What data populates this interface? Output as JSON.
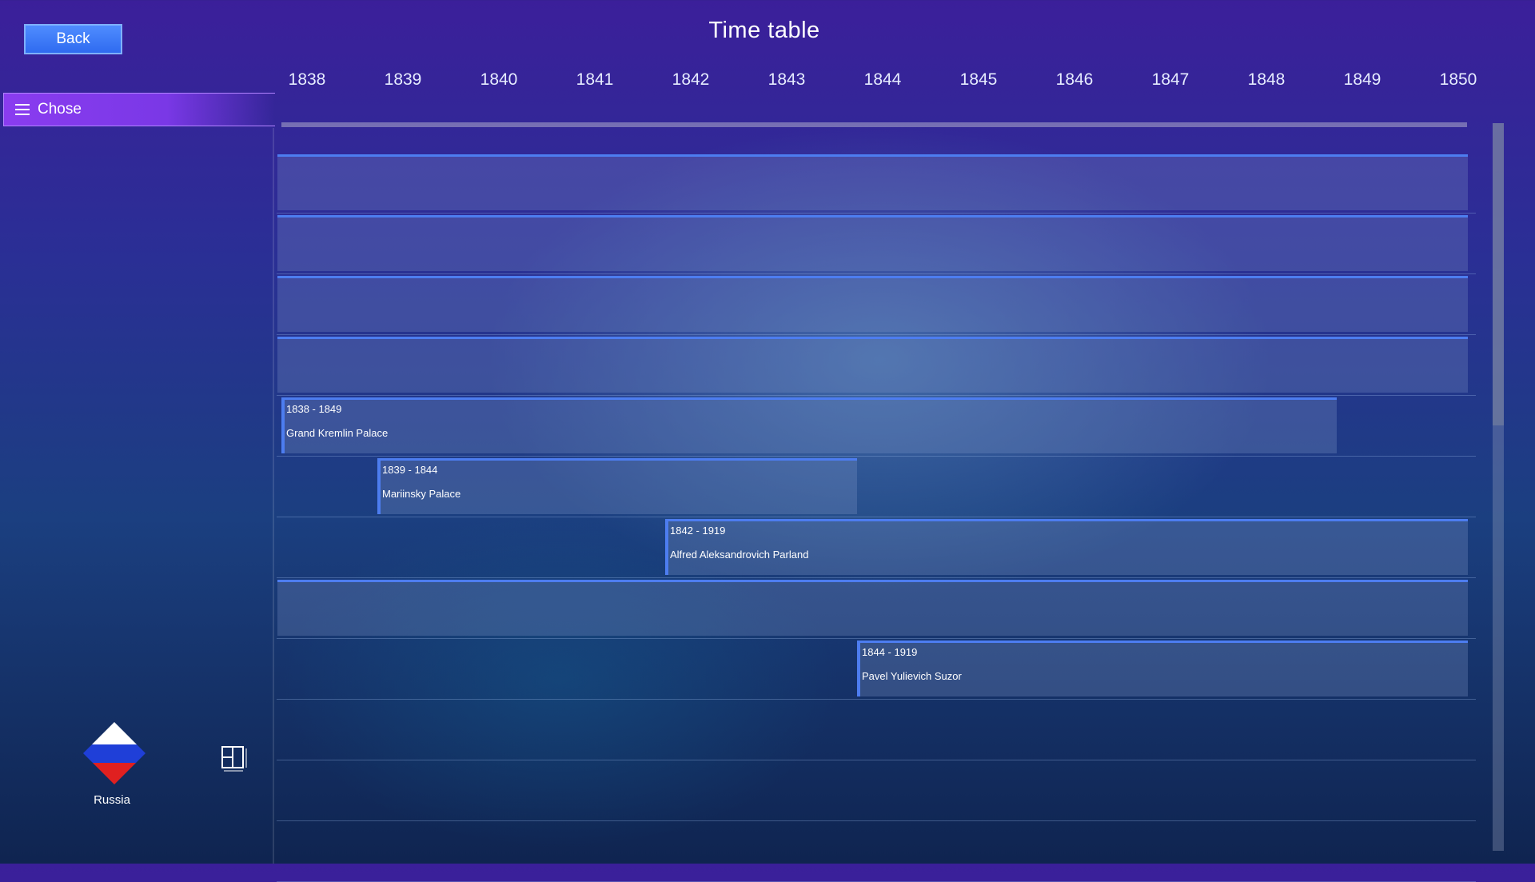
{
  "header": {
    "back_label": "Back",
    "title": "Time table"
  },
  "axis": {
    "years": [
      "1838",
      "1839",
      "1840",
      "1841",
      "1842",
      "1843",
      "1844",
      "1845",
      "1846",
      "1847",
      "1848",
      "1849",
      "1850"
    ]
  },
  "sidebar": {
    "chose_label": "Chose",
    "country": "Russia",
    "flag_colors": [
      "#ffffff",
      "#1f3fd8",
      "#e02020"
    ]
  },
  "timeline": {
    "range_start": 1838,
    "range_end": 1850,
    "rows": [
      {
        "type": "empty"
      },
      {
        "type": "empty"
      },
      {
        "type": "empty"
      },
      {
        "type": "empty"
      },
      {
        "type": "event",
        "dates": "1838 - 1849",
        "title": "Grand Kremlin Palace",
        "start": 1838,
        "end": 1849
      },
      {
        "type": "event",
        "dates": "1839 - 1844",
        "title": "Mariinsky Palace",
        "start": 1839,
        "end": 1844
      },
      {
        "type": "event",
        "dates": "1842 - 1919",
        "title": "Alfred Aleksandrovich Parland",
        "start": 1842,
        "end": 1919
      },
      {
        "type": "empty"
      },
      {
        "type": "event",
        "dates": "1844 - 1919",
        "title": "Pavel Yulievich Suzor",
        "start": 1844,
        "end": 1919
      },
      {
        "type": "none"
      },
      {
        "type": "none"
      },
      {
        "type": "none"
      }
    ]
  },
  "colors": {
    "accent": "#4d7df0",
    "chose_bar": "#8a3cf0",
    "back_button": "#3f7cff"
  }
}
